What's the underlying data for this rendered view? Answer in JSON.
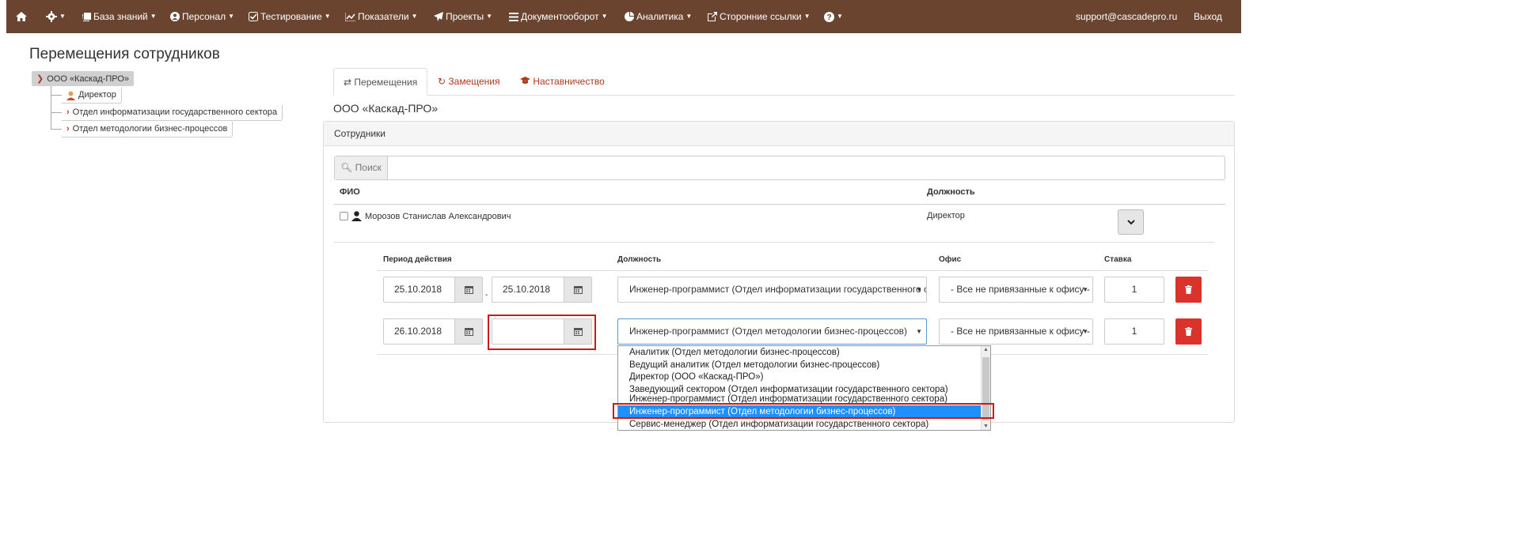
{
  "nav": {
    "items": [
      {
        "label": "База знаний",
        "icon": "book-icon"
      },
      {
        "label": "Персонал",
        "icon": "user-circle-icon"
      },
      {
        "label": "Тестирование",
        "icon": "check-square-icon"
      },
      {
        "label": "Показатели",
        "icon": "line-chart-icon"
      },
      {
        "label": "Проекты",
        "icon": "paper-plane-icon"
      },
      {
        "label": "Документооборот",
        "icon": "list-icon"
      },
      {
        "label": "Аналитика",
        "icon": "pie-chart-icon"
      },
      {
        "label": "Сторонние ссылки",
        "icon": "external-link-icon"
      }
    ],
    "email": "support@cascadepro.ru",
    "logout": "Выход"
  },
  "page": {
    "title": "Перемещения сотрудников"
  },
  "tree": {
    "root": "ООО «Каскад-ПРО»",
    "items": [
      "Директор",
      "Отдел информатизации государственного сектора",
      "Отдел методологии бизнес-процессов"
    ]
  },
  "tabs": [
    "Перемещения",
    "Замещения",
    "Наставничество"
  ],
  "org_title": "ООО «Каскад-ПРО»",
  "panel": {
    "title": "Сотрудники",
    "search_label": "Поиск",
    "col_name": "ФИО",
    "col_position": "Должность"
  },
  "employee": {
    "name": "Морозов Станислав Александрович",
    "position": "Директор"
  },
  "subtable": {
    "col_period": "Период действия",
    "col_position": "Должность",
    "col_office": "Офис",
    "col_rate": "Ставка",
    "separator": "-",
    "rows": [
      {
        "from": "25.10.2018",
        "to": "25.10.2018",
        "position": "Инженер-программист (Отдел информатизации государственного сектора)",
        "office": "- Все не привязанные к офису -",
        "rate": "1"
      },
      {
        "from": "26.10.2018",
        "to": "",
        "position": "Инженер-программист (Отдел методологии бизнес-процессов)",
        "office": "- Все не привязанные к офису -",
        "rate": "1"
      }
    ]
  },
  "dropdown": {
    "options": [
      "Аналитик (Отдел методологии бизнес-процессов)",
      "Ведущий аналитик (Отдел методологии бизнес-процессов)",
      "Директор (ООО «Каскад-ПРО»)",
      "Заведующий сектором (Отдел информатизации государственного сектора)",
      "Инженер-программист (Отдел информатизации государственного сектора)",
      "Инженер-программист (Отдел методологии бизнес-процессов)",
      "Сервис-менеджер (Отдел информатизации государственного сектора)"
    ],
    "selected_index": 5
  },
  "colors": {
    "navbar": "#6b4430",
    "accent": "#b03a1c",
    "danger": "#d9332b",
    "highlight": "#1e90ff"
  }
}
